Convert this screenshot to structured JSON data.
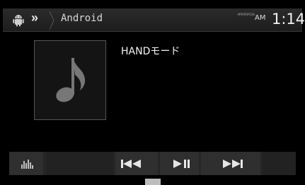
{
  "header": {
    "source_icon": "android-icon",
    "breadcrumb_chevron": "»",
    "source_name": "Android",
    "mpx_indicator": "MPXPOPCHL",
    "ampm": "AM",
    "time": "1:14"
  },
  "now_playing": {
    "artwork_icon": "music-note-icon",
    "track_title": "HANDモード"
  },
  "controls": {
    "equalizer_icon": "equalizer-icon",
    "previous_icon": "skip-back-icon",
    "play_pause_icon": "play-pause-icon",
    "next_icon": "skip-forward-icon"
  }
}
